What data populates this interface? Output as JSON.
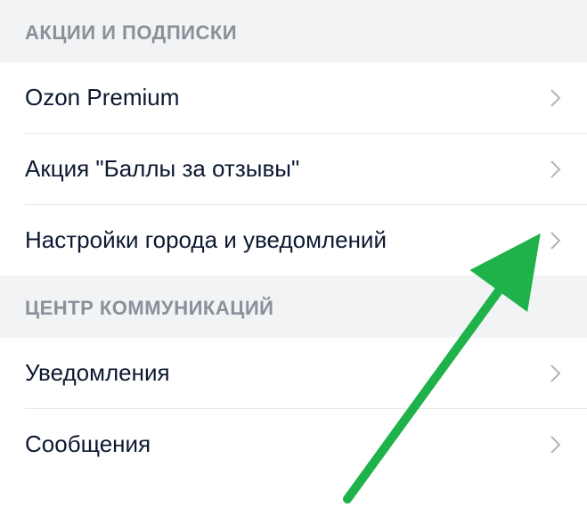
{
  "sections": [
    {
      "header": "АКЦИИ И ПОДПИСКИ",
      "items": [
        {
          "label": "Ozon Premium"
        },
        {
          "label": "Акция \"Баллы за отзывы\""
        },
        {
          "label": "Настройки города и уведомлений"
        }
      ]
    },
    {
      "header": "ЦЕНТР КОММУНИКАЦИЙ",
      "items": [
        {
          "label": "Уведомления"
        },
        {
          "label": "Сообщения"
        }
      ]
    }
  ],
  "annotation": {
    "arrow_color": "#1fb24a"
  }
}
